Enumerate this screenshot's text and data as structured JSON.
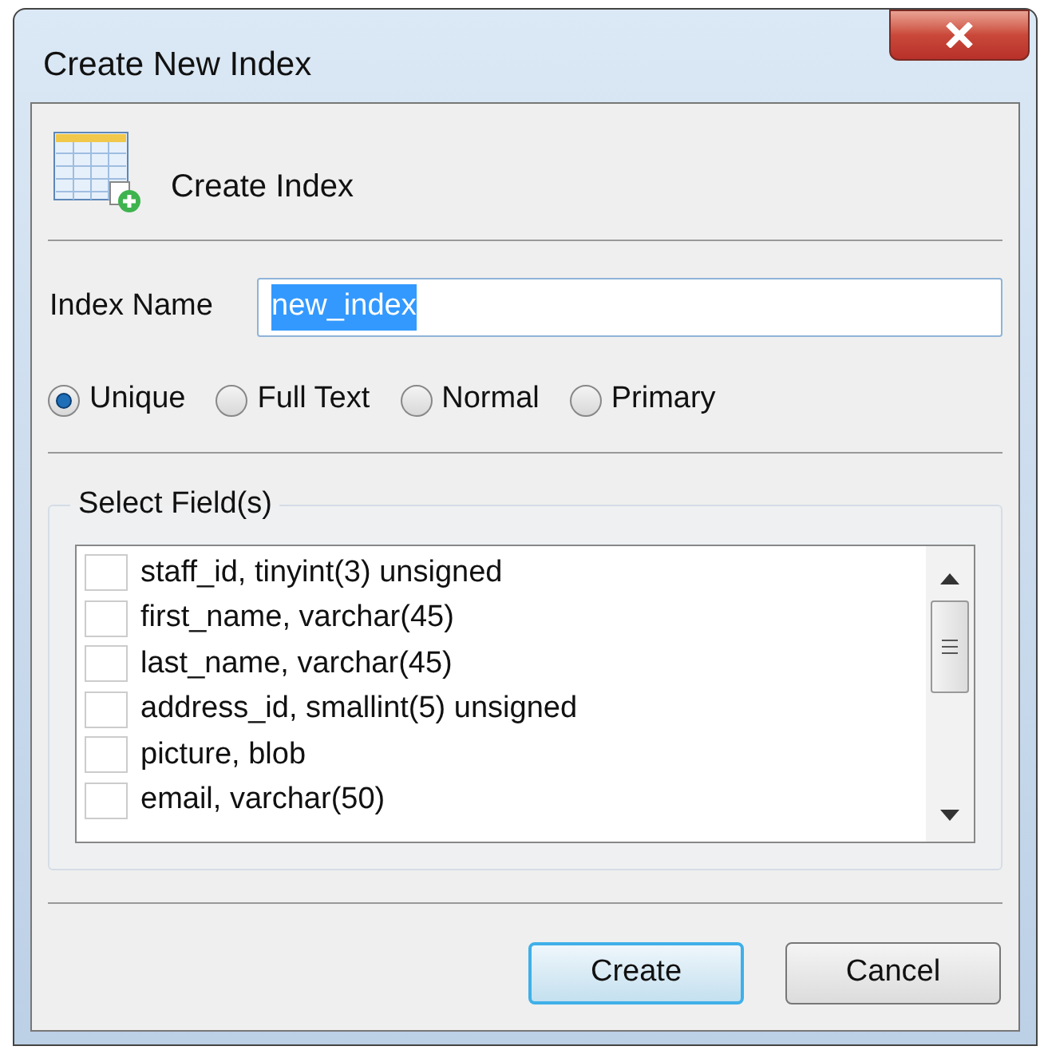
{
  "window": {
    "title": "Create New Index"
  },
  "header": {
    "title": "Create Index"
  },
  "index_name": {
    "label": "Index Name",
    "value": "new_index"
  },
  "index_types": [
    {
      "label": "Unique",
      "selected": true
    },
    {
      "label": "Full Text",
      "selected": false
    },
    {
      "label": "Normal",
      "selected": false
    },
    {
      "label": "Primary",
      "selected": false
    }
  ],
  "fields_group": {
    "title": "Select Field(s)",
    "items": [
      {
        "label": "staff_id, tinyint(3) unsigned",
        "checked": false
      },
      {
        "label": "first_name, varchar(45)",
        "checked": false
      },
      {
        "label": "last_name, varchar(45)",
        "checked": false
      },
      {
        "label": "address_id, smallint(5) unsigned",
        "checked": false
      },
      {
        "label": "picture, blob",
        "checked": false
      },
      {
        "label": "email, varchar(50)",
        "checked": false
      }
    ]
  },
  "buttons": [
    {
      "label": "Create",
      "kind": "default"
    },
    {
      "label": "Cancel",
      "kind": "normal"
    }
  ]
}
